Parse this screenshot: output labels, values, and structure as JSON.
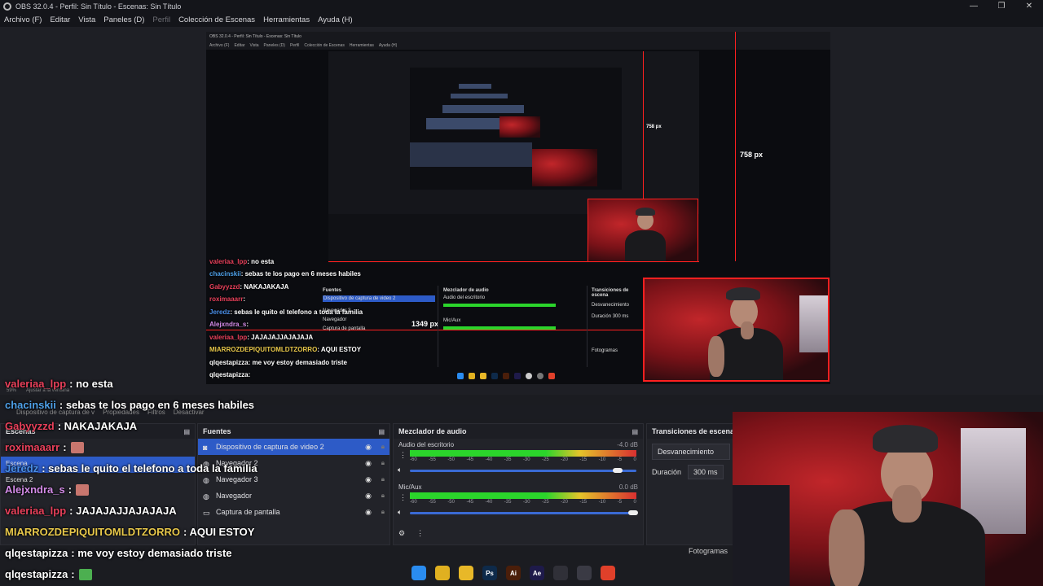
{
  "window": {
    "title": "OBS 32.0.4 - Perfil: Sin Título - Escenas: Sin Título",
    "controls": [
      "—",
      "❐",
      "✕"
    ]
  },
  "menu": [
    "Archivo (F)",
    "Editar",
    "Vista",
    "Paneles (D)",
    "Perfil",
    "Colección de Escenas",
    "Herramientas",
    "Ayuda (H)"
  ],
  "inner": {
    "title": "OBS 32.0.4 - Perfil: Sin Título - Escenas: Sin Título",
    "menu": [
      "Archivo (F)",
      "Editar",
      "Vista",
      "Paneles (D)",
      "Perfil",
      "Colección de Escenas",
      "Herramientas",
      "Ayuda (H)"
    ],
    "measure_758_small": "758 px",
    "measure_758": "758 px",
    "measure_1349": "1349 px",
    "chat": [
      {
        "user": "valeriaa_lpp",
        "text": ": no esta"
      },
      {
        "user": "chacinskii",
        "text": ": sebas te los pago en 6 meses habiles"
      },
      {
        "user": "Gabyyzzd",
        "text": ": NAKAJAKAJA"
      },
      {
        "user": "roximaaarr",
        "text": ":"
      },
      {
        "user": "Jeredz",
        "text": ": sebas le quito el telefono a toda la familia"
      },
      {
        "user": "Alejxndra_s",
        "text": ":"
      },
      {
        "user": "valeriaa_lpp",
        "text": ": JAJAJAJJAJAJAJA"
      },
      {
        "user": "MIARROZDEPIQUITOMLDTZORRO",
        "text": ": AQUI ESTOY"
      },
      {
        "user": "qlqestapizza",
        "text": ": me voy estoy demasiado triste"
      },
      {
        "user": "qlqestapizza",
        "text": ":"
      }
    ],
    "docks": {
      "fuentes": "Fuentes",
      "mixer": "Mezclador de audio",
      "transiciones": "Transiciones de escena",
      "source1": "Dispositivo de captura de video 2",
      "source2": "Navegador 3",
      "source3": "Navegador",
      "source4": "Captura de pantalla",
      "track1": "Audio del escritorio",
      "track2": "Mic/Aux",
      "trans": "Desvanecimiento",
      "dur_label": "Duración",
      "dur": "300 ms",
      "fotogramas": "Fotogramas"
    }
  },
  "status": {
    "zoom": "59%",
    "fit": "Ajustar a la ventana"
  },
  "toolbar": {
    "device": "Dispositivo de captura de v",
    "props": "Propiedades",
    "filters": "Filtros",
    "deactivate": "Desactivar"
  },
  "docks": {
    "escenas": {
      "title": "Escenas",
      "items": [
        "Escena",
        "Escena 2"
      ]
    },
    "fuentes": {
      "title": "Fuentes",
      "items": [
        {
          "label": "Dispositivo de captura de video 2",
          "icon": "camera-icon",
          "selected": true
        },
        {
          "label": "Navegador 2",
          "icon": "globe-icon",
          "selected": false
        },
        {
          "label": "Navegador 3",
          "icon": "globe-icon",
          "selected": false
        },
        {
          "label": "Navegador",
          "icon": "globe-icon",
          "selected": false
        },
        {
          "label": "Captura de pantalla",
          "icon": "monitor-icon",
          "selected": false
        }
      ]
    },
    "mixer": {
      "title": "Mezclador de audio",
      "tracks": [
        {
          "name": "Audio del escritorio",
          "db": "-4.0 dB",
          "volume": 0.93
        },
        {
          "name": "Mic/Aux",
          "db": "0.0 dB",
          "volume": 1.0
        }
      ],
      "scale": [
        "-60",
        "-55",
        "-50",
        "-45",
        "-40",
        "-35",
        "-30",
        "-25",
        "-20",
        "-15",
        "-10",
        "-5",
        "0"
      ]
    },
    "transiciones": {
      "title": "Transiciones de escena",
      "type": "Desvanecimiento",
      "duration_label": "Duración",
      "duration": "300 ms"
    }
  },
  "chat": [
    {
      "user": "valeriaa_lpp",
      "color": "#e8405a",
      "text": ": no esta",
      "emote": false
    },
    {
      "user": "chacinskii",
      "color": "#4ea0e8",
      "text": ": sebas te los pago en 6 meses habiles",
      "emote": false
    },
    {
      "user": "Gabyyzzd",
      "color": "#e8405a",
      "text": ": NAKAJAKAJA",
      "emote": false
    },
    {
      "user": "roximaaarr",
      "color": "#e8405a",
      "text": ":",
      "emote": true
    },
    {
      "user": "Jeredz",
      "color": "#4a8fe8",
      "text": ": sebas le quito el telefono a toda la familia",
      "emote": false
    },
    {
      "user": "Alejxndra_s",
      "color": "#d48be8",
      "text": ":",
      "emote": true
    },
    {
      "user": "valeriaa_lpp",
      "color": "#e8405a",
      "text": ": JAJAJAJJAJAJAJA",
      "emote": false
    },
    {
      "user": "MIARROZDEPIQUITOMLDTZORRO",
      "color": "#e8c84a",
      "text": ": AQUI ESTOY",
      "emote": false
    },
    {
      "user": "qlqestapizza",
      "color": "#ffffff",
      "text": ": me voy estoy demasiado triste",
      "emote": false
    },
    {
      "user": "qlqestapizza",
      "color": "#ffffff",
      "text": ":",
      "emote": true
    }
  ],
  "bottom_status": "Fotogramas",
  "taskbar": [
    {
      "name": "windows-start-icon",
      "label": "",
      "color": "#2a8cf0"
    },
    {
      "name": "chrome-icon",
      "label": "",
      "color": "#e0b020"
    },
    {
      "name": "file-explorer-icon",
      "label": "",
      "color": "#e8b828"
    },
    {
      "name": "photoshop-icon",
      "label": "Ps",
      "color": "#0e2a4a"
    },
    {
      "name": "illustrator-icon",
      "label": "Ai",
      "color": "#4a1e0a"
    },
    {
      "name": "after-effects-icon",
      "label": "Ae",
      "color": "#1e1a4a"
    },
    {
      "name": "obs-icon",
      "label": "",
      "color": "#303038"
    },
    {
      "name": "recording-icon",
      "label": "",
      "color": "#3a3a44"
    },
    {
      "name": "brave-icon",
      "label": "",
      "color": "#e0402a"
    }
  ],
  "colors": {
    "accent": "#2d5bc7",
    "highlight_red": "#ff2020",
    "background": "#1e1f25"
  }
}
